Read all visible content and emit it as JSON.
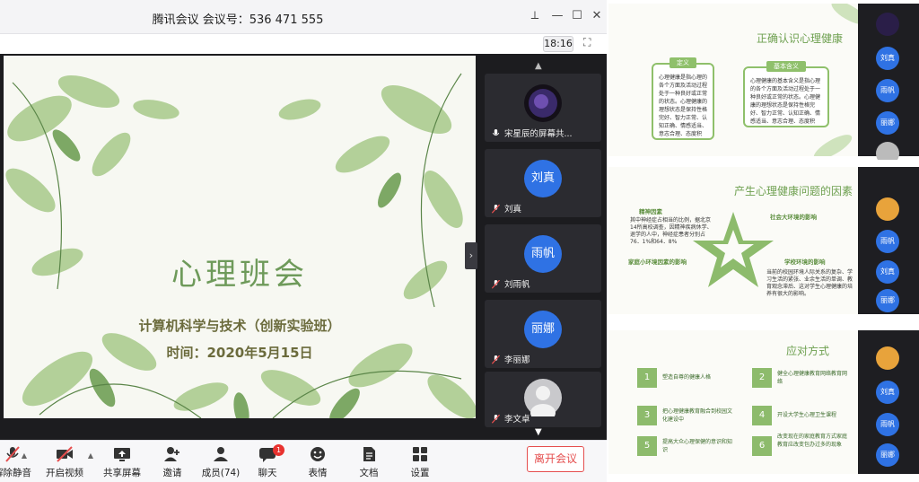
{
  "window": {
    "title": "腾讯会议 会议号：536 471 555",
    "clock": "18:16"
  },
  "slide": {
    "title": "心理班会",
    "subtitle": "计算机科学与技术（创新实验班）",
    "date": "时间：2020年5月15日"
  },
  "participants": [
    {
      "name": "宋星辰的屏幕共...",
      "avatar": ""
    },
    {
      "name": "刘真",
      "avatar": "刘真"
    },
    {
      "name": "刘雨帆",
      "avatar": "雨帆"
    },
    {
      "name": "李丽娜",
      "avatar": "丽娜"
    },
    {
      "name": "李文卓",
      "avatar": ""
    }
  ],
  "toolbar": {
    "mute": "解除静音",
    "video": "开启视频",
    "share": "共享屏幕",
    "invite": "邀请",
    "members": "成员(74)",
    "chat": "聊天",
    "chat_badge": "1",
    "emoji": "表情",
    "docs": "文档",
    "settings": "设置",
    "leave": "离开会议"
  },
  "thumb1": {
    "title": "正确认识心理健康",
    "box1_head": "定义",
    "box1_text": "心理健康是指心理的各个方面及活动过程处于一种良好或正常的状态。心理健康的理想状态是保持性格完好、智力正常、认知正确、情感适当、意志合理、态度积极、行为恰当、适应良好的状态。",
    "box2_head": "基本含义",
    "box2_text": "心理健康的基本含义是指心理的各个方面及活动过程处于一种良好或正常的状态。心理健康的理想状态是保持性格完好、智力正常、认知正确、情感适当、意志合理、态度积极、行为恰当、适应良好的状态。与心理健康相对应的是心理亚健康以及心理疾病。心理健康从不同的角度有不同的含义，衡量标准也有所不同。",
    "side": [
      "刘真",
      "雨帆",
      "丽娜"
    ]
  },
  "thumb2": {
    "title": "产生心理健康问题的因素",
    "f1_head": "精神因素",
    "f1_text": "其中神经症占相当的比例，据北京14所高校调查，因精神疾病休学、退学的人中，神经症患者分别占76．1%和64．8%",
    "f2_head": "社会大环境的影响",
    "f3_head": "家庭小环境因素的影响",
    "f4_head": "学校环境的影响",
    "f4_text": "当前的校园环境人际关系的复杂、学习生活的紧张、业余生活的单调、教育观念滞后、这对学生心理健康的培养有很大的影响。",
    "side": [
      "雨帆",
      "刘真",
      "丽娜"
    ]
  },
  "thumb3": {
    "title": "应对方式",
    "items": [
      {
        "n": "1",
        "text": "塑造自尊的健康人格"
      },
      {
        "n": "2",
        "text": "健全心理健康教育网络教育网络"
      },
      {
        "n": "3",
        "text": "把心理健康教育融合到校园文化建设中"
      },
      {
        "n": "4",
        "text": "开设大学生心理卫生课程"
      },
      {
        "n": "5",
        "text": "提高大众心理保健的意识和知识"
      },
      {
        "n": "6",
        "text": "改变现在的家庭教育方式家庭教育应改变包办过多的现象"
      }
    ],
    "side": [
      "刘真",
      "雨帆",
      "丽娜"
    ]
  },
  "colors": {
    "accent_blue": "#2f72e4",
    "leaf_green": "#8dbb6c",
    "leave_red": "#e54e4e"
  }
}
